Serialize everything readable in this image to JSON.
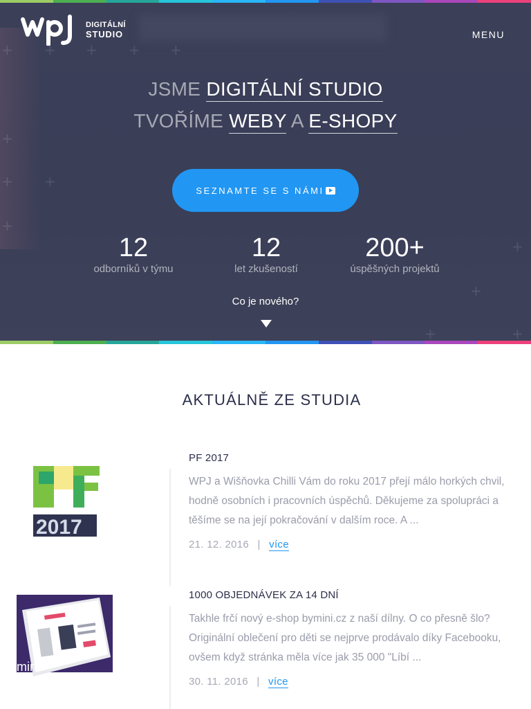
{
  "header": {
    "logo_mark": "wpj",
    "logo_line1": "DIGITÁLNÍ",
    "logo_line2": "STUDIO",
    "menu_label": "MENU"
  },
  "hero": {
    "line1_prefix": "JSME",
    "line1_link": "DIGITÁLNÍ STUDIO",
    "line2_prefix": "TVOŘÍME",
    "line2_link1": "WEBY",
    "line2_mid": "A",
    "line2_link2": "E-SHOPY",
    "cta_label": "SEZNAMTE SE S NÁMI",
    "stats": [
      {
        "value": "12",
        "label": "odborníků v týmu"
      },
      {
        "value": "12",
        "label": "let zkušeností"
      },
      {
        "value": "200+",
        "label": "úspěšných projektů"
      }
    ],
    "whats_new": "Co je nového?"
  },
  "colors": {
    "accent": "#2196f3",
    "hero_bg": "#3b3f58",
    "stripe": [
      "#9ccc65",
      "#4caf50",
      "#26a69a",
      "#26c6da",
      "#29b6f6",
      "#2196f3",
      "#3f51b5",
      "#7e57c2",
      "#ab47bc",
      "#ec407a"
    ]
  },
  "news": {
    "section_title": "AKTUÁLNĚ ZE STUDIA",
    "items": [
      {
        "title": "PF 2017",
        "excerpt": "WPJ a Wišňovka Chilli Vám do roku 2017 přejí málo horkých chvil, hodně osobních i pracovních úspěchů. Děkujeme za spolupráci a těšíme se na její pokračování v dalším roce. A ...",
        "date": "21. 12. 2016",
        "separator": "|",
        "more": "více",
        "thumb_text": "PF",
        "thumb_year": "2017"
      },
      {
        "title": "1000 OBJEDNÁVEK ZA 14 DNÍ",
        "excerpt": "Takhle frčí nový e-shop bymini.cz z naší dílny. O co přesně šlo? Originální oblečení pro děti se nejprve prodávalo díky Facebooku, ovšem když stránka měla více jak 35 000 \"Líbí ...",
        "date": "30. 11. 2016",
        "separator": "|",
        "more": "více",
        "thumb_text": "mini"
      }
    ]
  }
}
